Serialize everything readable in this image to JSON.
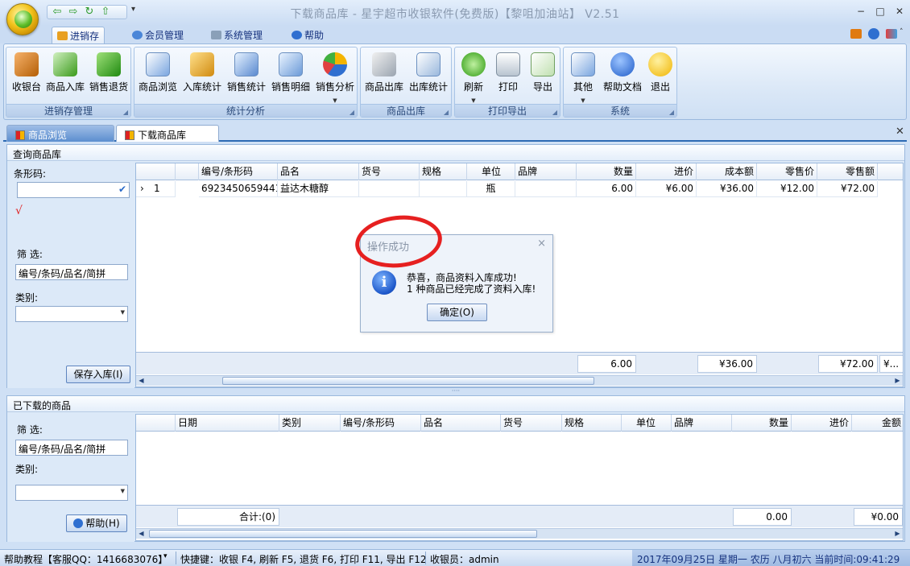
{
  "window": {
    "title": "下载商品库 - 星宇超市收银软件(免费版)【黎咀加油站】 V2.51",
    "controls": {
      "minimize": "−",
      "restore": "□",
      "close": "✕"
    }
  },
  "ribbon_tabs": [
    {
      "label": "进销存",
      "active": true
    },
    {
      "label": "会员管理",
      "active": false
    },
    {
      "label": "系统管理",
      "active": false
    },
    {
      "label": "帮助",
      "active": false
    }
  ],
  "ribbon_groups": {
    "inventory": {
      "caption": "进销存管理",
      "buttons": [
        "收银台",
        "商品入库",
        "销售退货"
      ]
    },
    "stats": {
      "caption": "统计分析",
      "buttons": [
        "商品浏览",
        "入库统计",
        "销售统计",
        "销售明细",
        "销售分析"
      ]
    },
    "outbound": {
      "caption": "商品出库",
      "buttons": [
        "商品出库",
        "出库统计"
      ]
    },
    "print": {
      "caption": "打印导出",
      "buttons": [
        "刷新",
        "打印",
        "导出"
      ]
    },
    "system": {
      "caption": "系统",
      "buttons": [
        "其他",
        "帮助文档",
        "退出"
      ]
    }
  },
  "doc_tabs": [
    {
      "label": "商品浏览",
      "active": false
    },
    {
      "label": "下载商品库",
      "active": true
    }
  ],
  "query_panel": {
    "title": "查询商品库",
    "barcode_label": "条形码:",
    "barcode_value": "",
    "check_mark": "√",
    "filter_label": "筛  选:",
    "filter_value": "编号/条码/品名/简拼",
    "category_label": "类别:",
    "category_value": "",
    "save_button": "保存入库(I)"
  },
  "query_grid": {
    "columns": [
      "",
      "",
      "编号/条形码",
      "品名",
      "货号",
      "规格",
      "单位",
      "品牌",
      "数量",
      "进价",
      "成本额",
      "零售价",
      "零售额"
    ],
    "rows": [
      {
        "indicator": "›",
        "no": "1",
        "barcode": "6923450659441",
        "name": "益达木糖醇",
        "item_no": "",
        "spec": "",
        "unit": "瓶",
        "brand": "",
        "qty": "6.00",
        "cost_price": "¥6.00",
        "cost_amount": "¥36.00",
        "retail_price": "¥12.00",
        "retail_amount": "¥72.00"
      }
    ],
    "totals": {
      "qty": "6.00",
      "cost_amount": "¥36.00",
      "retail_amount": "¥72.00",
      "more": "¥..."
    }
  },
  "downloaded_panel": {
    "title": "已下载的商品",
    "filter_label": "筛  选:",
    "filter_value": "编号/条码/品名/简拼",
    "category_label": "类别:",
    "help_button": "帮助(H)"
  },
  "downloaded_grid": {
    "columns": [
      "",
      "日期",
      "类别",
      "编号/条形码",
      "品名",
      "货号",
      "规格",
      "单位",
      "品牌",
      "数量",
      "进价",
      "金额"
    ],
    "totals": {
      "count": "合计:(0)",
      "qty": "0.00",
      "amount": "¥0.00"
    }
  },
  "dialog": {
    "title": "操作成功",
    "close": "×",
    "icon": "i",
    "line1": "恭喜，商品资料入库成功!",
    "line2": "1 种商品已经完成了资料入库!",
    "ok": "确定(O)"
  },
  "statusbar": {
    "help": "帮助教程【客服QQ：1416683076】",
    "shortcuts": "快捷键：收银 F4, 刷新 F5, 退货 F6, 打印 F11, 导出 F12",
    "cashier": "收银员：admin",
    "datetime": "2017年09月25日 星期一 农历 八月初六 当前时间:09:41:29"
  },
  "colors": {
    "accent": "#2d6ab4",
    "highlight": "#e62020",
    "ribbon_bg": "#dbe8f7"
  }
}
